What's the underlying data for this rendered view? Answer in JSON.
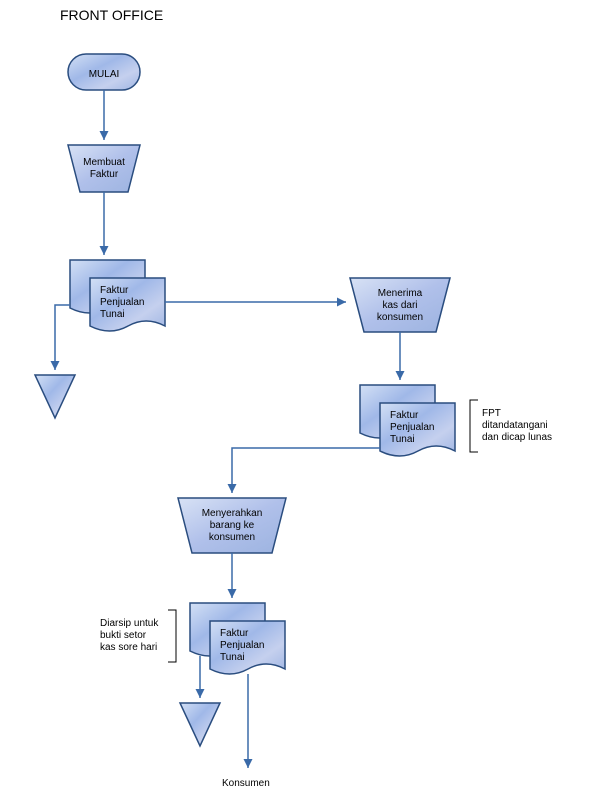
{
  "title": "FRONT OFFICE",
  "start": "MULAI",
  "process1": {
    "line1": "Membuat",
    "line2": "Faktur"
  },
  "doc1": {
    "line1": "Faktur",
    "line2": "Penjualan",
    "line3": "Tunai"
  },
  "process2": {
    "line1": "Menerima",
    "line2": "kas dari",
    "line3": "konsumen"
  },
  "doc2": {
    "line1": "Faktur",
    "line2": "Penjualan",
    "line3": "Tunai"
  },
  "annotation2": {
    "line1": "FPT",
    "line2": "ditandatangani",
    "line3": "dan dicap lunas"
  },
  "process3": {
    "line1": "Menyerahkan",
    "line2": "barang ke",
    "line3": "konsumen"
  },
  "doc3": {
    "line1": "Faktur",
    "line2": "Penjualan",
    "line3": "Tunai"
  },
  "annotation3": {
    "line1": "Diarsip untuk",
    "line2": "bukti setor",
    "line3": "kas sore hari"
  },
  "end": "Konsumen"
}
